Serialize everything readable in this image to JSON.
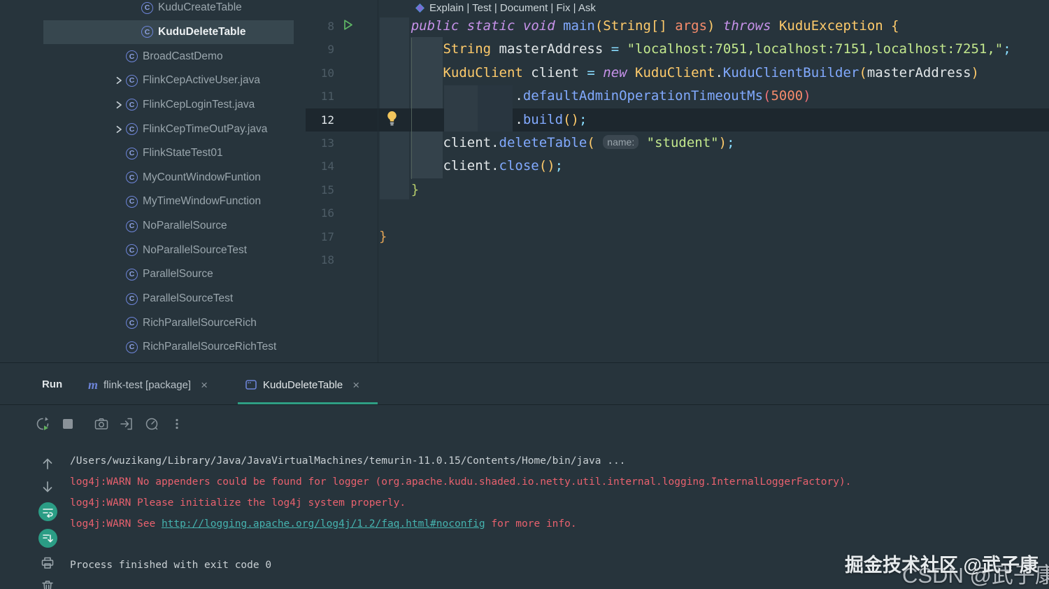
{
  "colors": {
    "background": "#27343c",
    "current_line": "#1d272e",
    "selection": "#37474f",
    "accent_teal": "#2f9e84",
    "toggle_teal": "#2b9d85",
    "error_red": "#e8616e",
    "link_teal": "#45b3af",
    "class_icon_blue": "#6d84d8",
    "run_green": "#5fb865",
    "bulb_yellow": "#f2c55c"
  },
  "sidebar": {
    "items": [
      {
        "label": "KuduCreateTable",
        "icon": "class-icon",
        "depth": 2,
        "chevron": false,
        "selected": false
      },
      {
        "label": "KuduDeleteTable",
        "icon": "class-icon",
        "depth": 2,
        "chevron": false,
        "selected": true
      },
      {
        "label": "BroadCastDemo",
        "icon": "class-icon",
        "depth": 1,
        "chevron": false,
        "selected": false
      },
      {
        "label": "FlinkCepActiveUser.java",
        "icon": "class-icon",
        "depth": 1,
        "chevron": true,
        "selected": false
      },
      {
        "label": "FlinkCepLoginTest.java",
        "icon": "class-icon",
        "depth": 1,
        "chevron": true,
        "selected": false
      },
      {
        "label": "FlinkCepTimeOutPay.java",
        "icon": "class-icon",
        "depth": 1,
        "chevron": true,
        "selected": false
      },
      {
        "label": "FlinkStateTest01",
        "icon": "class-icon",
        "depth": 1,
        "chevron": false,
        "selected": false
      },
      {
        "label": "MyCountWindowFuntion",
        "icon": "class-icon",
        "depth": 1,
        "chevron": false,
        "selected": false
      },
      {
        "label": "MyTimeWindowFunction",
        "icon": "class-icon",
        "depth": 1,
        "chevron": false,
        "selected": false
      },
      {
        "label": "NoParallelSource",
        "icon": "class-icon",
        "depth": 1,
        "chevron": false,
        "selected": false
      },
      {
        "label": "NoParallelSourceTest",
        "icon": "class-icon",
        "depth": 1,
        "chevron": false,
        "selected": false
      },
      {
        "label": "ParallelSource",
        "icon": "class-icon",
        "depth": 1,
        "chevron": false,
        "selected": false
      },
      {
        "label": "ParallelSourceTest",
        "icon": "class-icon",
        "depth": 1,
        "chevron": false,
        "selected": false
      },
      {
        "label": "RichParallelSourceRich",
        "icon": "class-icon",
        "depth": 1,
        "chevron": false,
        "selected": false
      },
      {
        "label": "RichParallelSourceRichTest",
        "icon": "class-icon",
        "depth": 1,
        "chevron": false,
        "selected": false
      }
    ]
  },
  "editor": {
    "ai_hint": {
      "icon": "ai-gem-icon",
      "actions": "Explain | Test | Document | Fix | Ask"
    },
    "current_line_number": 12,
    "lines": [
      {
        "num": 8,
        "run": true,
        "current": false,
        "indent": 4,
        "tokens": [
          [
            "kw",
            "public static void "
          ],
          [
            "fn",
            "main"
          ],
          [
            "py",
            "("
          ],
          [
            "cls",
            "String[] "
          ],
          [
            "arg",
            "args"
          ],
          [
            "py",
            ")"
          ],
          [
            "kw",
            " throws "
          ],
          [
            "cls",
            "KuduException"
          ],
          [
            "pl",
            " "
          ],
          [
            "py",
            "{"
          ]
        ]
      },
      {
        "num": 9,
        "run": false,
        "current": false,
        "indent": 8,
        "tokens": [
          [
            "cls",
            "String"
          ],
          [
            "pl",
            " masterAddress "
          ],
          [
            "op",
            "="
          ],
          [
            "pl",
            " "
          ],
          [
            "str",
            "\"localhost:7051,localhost:7151,localhost:7251,\""
          ],
          [
            "op",
            ";"
          ]
        ]
      },
      {
        "num": 10,
        "run": false,
        "current": false,
        "indent": 8,
        "tokens": [
          [
            "cls",
            "KuduClient"
          ],
          [
            "pl",
            " client "
          ],
          [
            "op",
            "="
          ],
          [
            "pl",
            " "
          ],
          [
            "kw",
            "new "
          ],
          [
            "cls",
            "KuduClient"
          ],
          [
            "pl",
            "."
          ],
          [
            "fn",
            "KuduClientBuilder"
          ],
          [
            "py",
            "("
          ],
          [
            "pl",
            "masterAddress"
          ],
          [
            "py",
            ")"
          ]
        ]
      },
      {
        "num": 11,
        "run": false,
        "current": false,
        "indent": 17,
        "tokens": [
          [
            "pl",
            "."
          ],
          [
            "fn",
            "defaultAdminOperationTimeoutMs"
          ],
          [
            "pr",
            "("
          ],
          [
            "num",
            "5000"
          ],
          [
            "pr",
            ")"
          ]
        ]
      },
      {
        "num": 12,
        "run": false,
        "current": true,
        "indent": 17,
        "tokens": [
          [
            "pl",
            "."
          ],
          [
            "fn",
            "build"
          ],
          [
            "py",
            "()"
          ],
          [
            "op",
            ";"
          ]
        ]
      },
      {
        "num": 13,
        "run": false,
        "current": false,
        "indent": 8,
        "tokens": [
          [
            "pl",
            "client."
          ],
          [
            "fn",
            "deleteTable"
          ],
          [
            "py",
            "("
          ],
          [
            "pl",
            " "
          ],
          [
            "hint",
            "name:"
          ],
          [
            "pl",
            " "
          ],
          [
            "str",
            "\"student\""
          ],
          [
            "py",
            ")"
          ],
          [
            "op",
            ";"
          ]
        ]
      },
      {
        "num": 14,
        "run": false,
        "current": false,
        "indent": 8,
        "tokens": [
          [
            "pl",
            "client."
          ],
          [
            "fn",
            "close"
          ],
          [
            "py",
            "()"
          ],
          [
            "op",
            ";"
          ]
        ]
      },
      {
        "num": 15,
        "run": false,
        "current": false,
        "indent": 4,
        "tokens": [
          [
            "bg",
            "}"
          ]
        ]
      },
      {
        "num": 16,
        "run": false,
        "current": false,
        "indent": 0,
        "tokens": []
      },
      {
        "num": 17,
        "run": false,
        "current": false,
        "indent": 0,
        "tokens": [
          [
            "bo",
            "}"
          ]
        ]
      },
      {
        "num": 18,
        "run": false,
        "current": false,
        "indent": 0,
        "tokens": []
      }
    ]
  },
  "run_panel": {
    "title": "Run",
    "close_glyph": "×",
    "tabs": [
      {
        "icon": "maven-icon",
        "icon_glyph": "m",
        "label": "flink-test [package]",
        "active": false
      },
      {
        "icon": "window-icon",
        "label": "KuduDeleteTable",
        "active": true
      }
    ],
    "toolbar_icons": [
      "rerun",
      "stop",
      "screenshot",
      "attach-debugger",
      "profiler",
      "more-options"
    ],
    "console": {
      "gutter_icons": [
        "scroll-up",
        "scroll-down",
        "soft-wrap",
        "scroll-to-end",
        "print",
        "clear-all"
      ],
      "lines": [
        {
          "gap": false,
          "segs": [
            [
              "plain",
              "/Users/wuzikang/Library/Java/JavaVirtualMachines/temurin-11.0.15/Contents/Home/bin/java ..."
            ]
          ]
        },
        {
          "gap": false,
          "segs": [
            [
              "err",
              "log4j:WARN No appenders could be found for logger (org.apache.kudu.shaded.io.netty.util.internal.logging.InternalLoggerFactory)."
            ]
          ]
        },
        {
          "gap": false,
          "segs": [
            [
              "err",
              "log4j:WARN Please initialize the log4j system properly."
            ]
          ]
        },
        {
          "gap": false,
          "segs": [
            [
              "err",
              "log4j:WARN See "
            ],
            [
              "link",
              "http://logging.apache.org/log4j/1.2/faq.html#noconfig"
            ],
            [
              "err",
              " for more info."
            ]
          ]
        },
        {
          "gap": true,
          "segs": [
            [
              "plain",
              "Process finished with exit code 0"
            ]
          ]
        }
      ]
    }
  },
  "watermark": {
    "line1": "掘金技术社区 @武子康",
    "line2": "CSDN @武子康"
  }
}
